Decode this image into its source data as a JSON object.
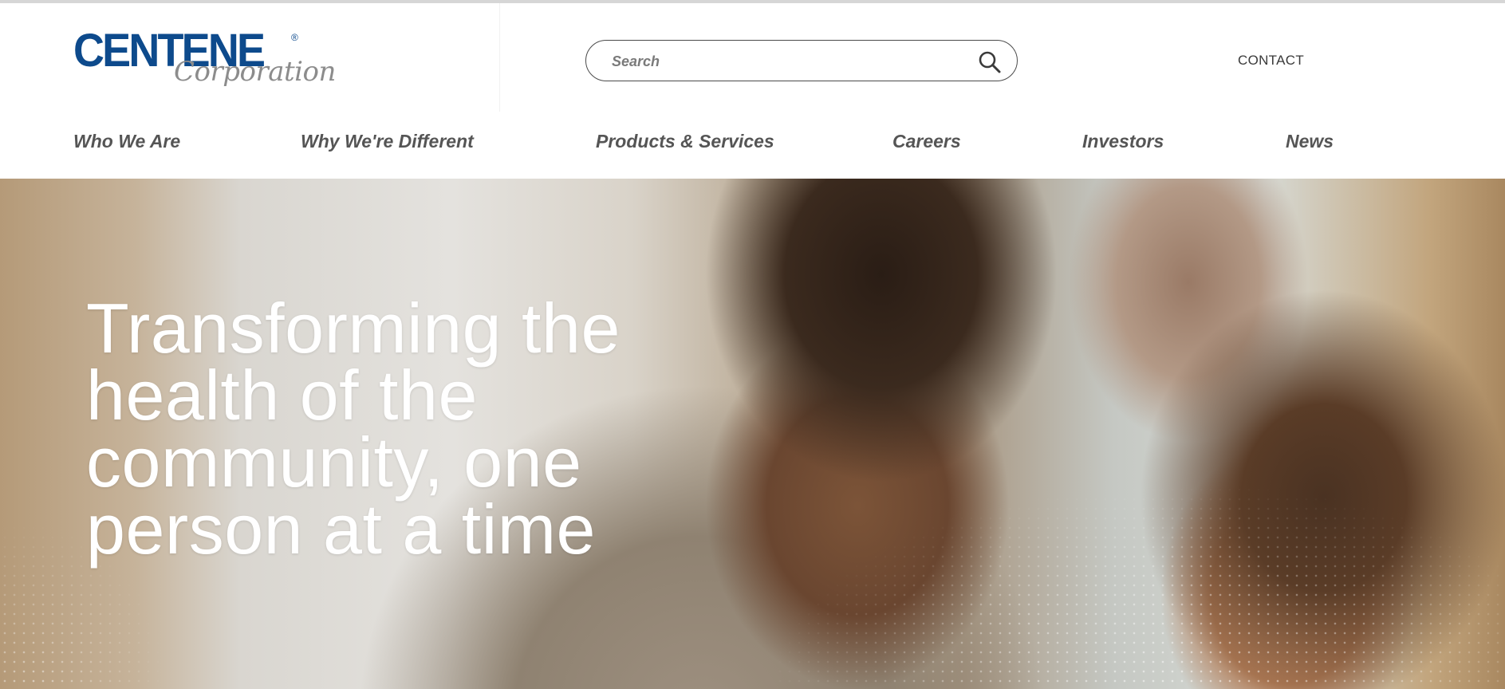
{
  "brand": {
    "name": "CENTENE",
    "registered_mark": "®",
    "subtitle": "Corporation",
    "primary_color": "#0d4a8c",
    "secondary_color": "#8c8c8c"
  },
  "search": {
    "placeholder": "Search",
    "icon": "search-icon"
  },
  "header": {
    "contact_label": "CONTACT"
  },
  "nav": {
    "items": [
      {
        "label": "Who We Are"
      },
      {
        "label": "Why We're Different"
      },
      {
        "label": "Products & Services"
      },
      {
        "label": "Careers"
      },
      {
        "label": "Investors"
      },
      {
        "label": "News"
      }
    ]
  },
  "hero": {
    "headline_lines": [
      "Transforming the",
      "health of the",
      "community, one",
      "person at a time"
    ]
  }
}
